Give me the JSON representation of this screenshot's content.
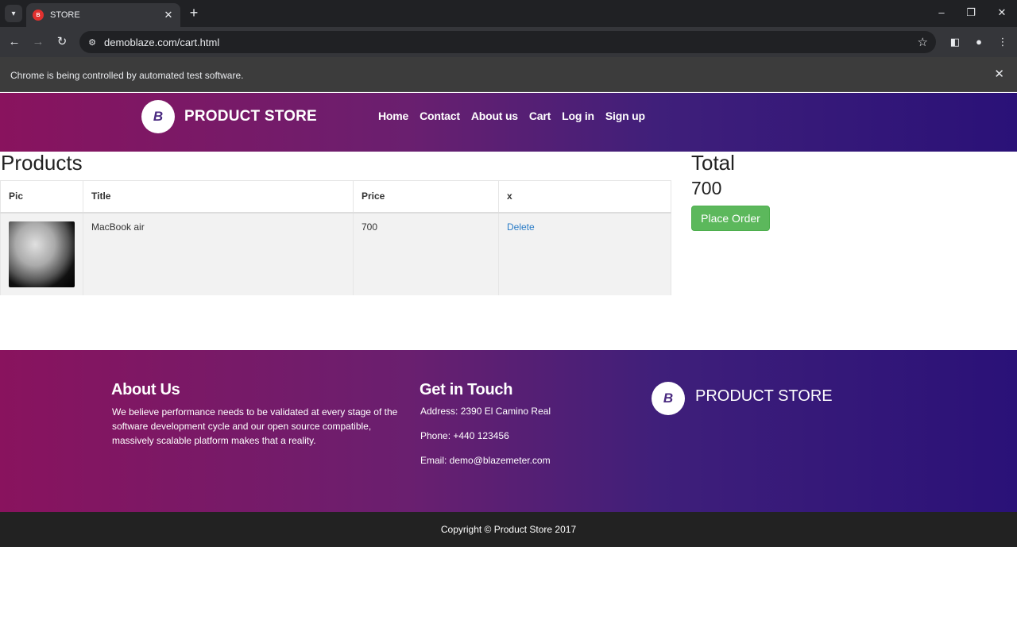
{
  "browser": {
    "tab_title": "STORE",
    "favicon_text": "B",
    "url": "demoblaze.com/cart.html",
    "infobar_text": "Chrome is being controlled by automated test software.",
    "icons": {
      "tab_dropdown": "chevron-down-icon",
      "tab_close": "close-icon",
      "new_tab": "plus-icon",
      "minimize": "minimize-icon",
      "maximize": "restore-icon",
      "close": "close-icon",
      "back": "back-arrow-icon",
      "forward": "forward-arrow-icon",
      "reload": "reload-icon",
      "site_info": "tune-icon",
      "bookmark": "star-icon",
      "side_panel": "side-panel-icon",
      "profile": "profile-icon",
      "menu": "kebab-menu-icon"
    }
  },
  "header": {
    "logo_letter": "B",
    "brand": "PRODUCT STORE",
    "nav": [
      "Home",
      "Contact",
      "About us",
      "Cart",
      "Log in",
      "Sign up"
    ]
  },
  "cart": {
    "title": "Products",
    "columns": [
      "Pic",
      "Title",
      "Price",
      "x"
    ],
    "rows": [
      {
        "title": "MacBook air",
        "price": "700",
        "action": "Delete"
      }
    ]
  },
  "summary": {
    "label": "Total",
    "value": "700",
    "button": "Place Order",
    "button_color": "#5cb85c"
  },
  "footer": {
    "about_title": "About Us",
    "about_text": "We believe performance needs to be validated at every stage of the software development cycle and our open source compatible, massively scalable platform makes that a reality.",
    "contact_title": "Get in Touch",
    "address": "Address: 2390 El Camino Real",
    "phone": "Phone: +440 123456",
    "email": "Email: demo@blazemeter.com",
    "brand": "PRODUCT STORE",
    "copyright": "Copyright © Product Store 2017"
  },
  "colors": {
    "header_gradient_start": "#89135e",
    "header_gradient_end": "#2a1178",
    "link": "#2a7cc7"
  }
}
